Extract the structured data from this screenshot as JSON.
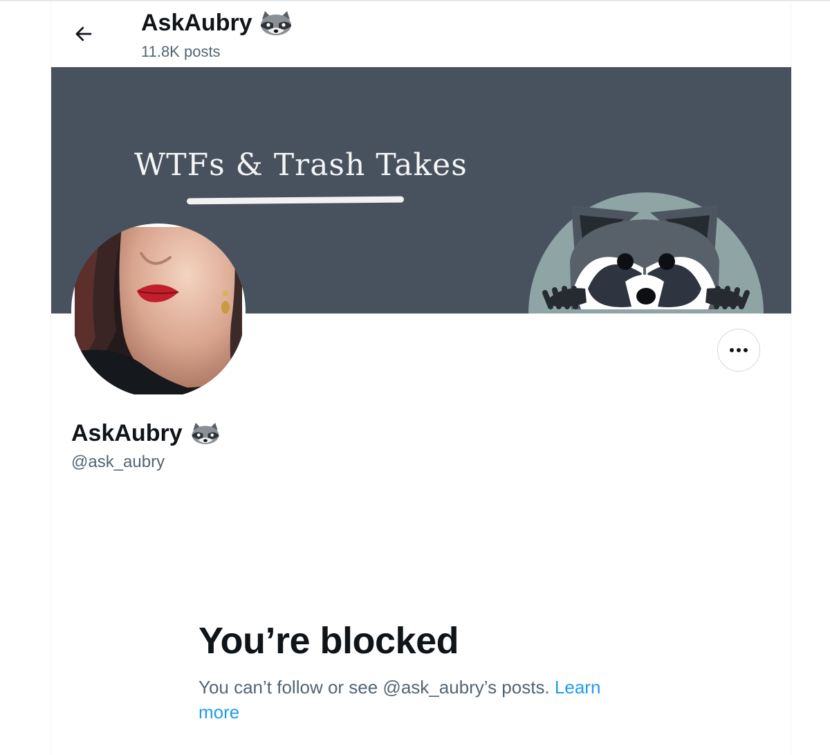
{
  "header": {
    "back_icon": "arrow-left-icon",
    "title": "AskAubry",
    "title_emoji": "raccoon",
    "posts_count": "11.8K posts"
  },
  "banner": {
    "text": "WTFs & Trash Takes",
    "background_color": "#48525f"
  },
  "profile": {
    "name": "AskAubry",
    "name_emoji": "raccoon",
    "handle": "@ask_aubry",
    "more_icon": "more-horizontal-icon"
  },
  "blocked": {
    "title": "You’re blocked",
    "message": "You can’t follow or see @ask_aubry’s posts.",
    "link": "Learn more",
    "link_color": "#1d9bf0"
  }
}
